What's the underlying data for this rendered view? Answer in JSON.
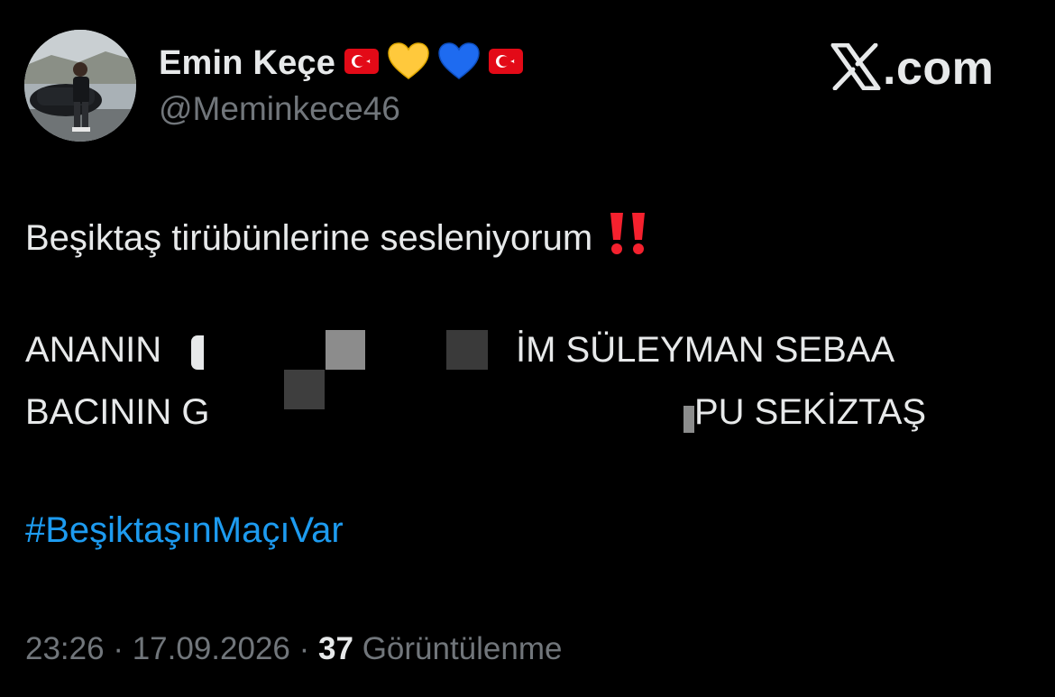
{
  "author": {
    "display_name": "Emin Keçe",
    "handle": "@Meminkece46",
    "name_emojis": [
      "flag-turkey-icon",
      "yellow-heart-icon",
      "blue-heart-icon",
      "flag-turkey-icon"
    ]
  },
  "brand": {
    "label": ".com",
    "icon": "x-logo-icon"
  },
  "tweet": {
    "line1": "Beşiktaş tirübünlerine sesleniyorum",
    "line1_emoji": "double-exclamation-icon",
    "line2_start": "ANANIN",
    "line2_end": "İM SÜLEYMAN SEBAA",
    "line3_start": "BACININ G",
    "line3_end": "PU SEKİZTAŞ",
    "hashtag": "#BeşiktaşınMaçıVar"
  },
  "meta": {
    "time": "23:26",
    "separator": "·",
    "date": "17.09.2026",
    "views_count": "37",
    "views_label": "Görüntülenme"
  },
  "colors": {
    "background": "#000000",
    "text": "#e7e9ea",
    "secondary": "#71767b",
    "link": "#1d9bf0",
    "exclamation": "#f4212e"
  }
}
